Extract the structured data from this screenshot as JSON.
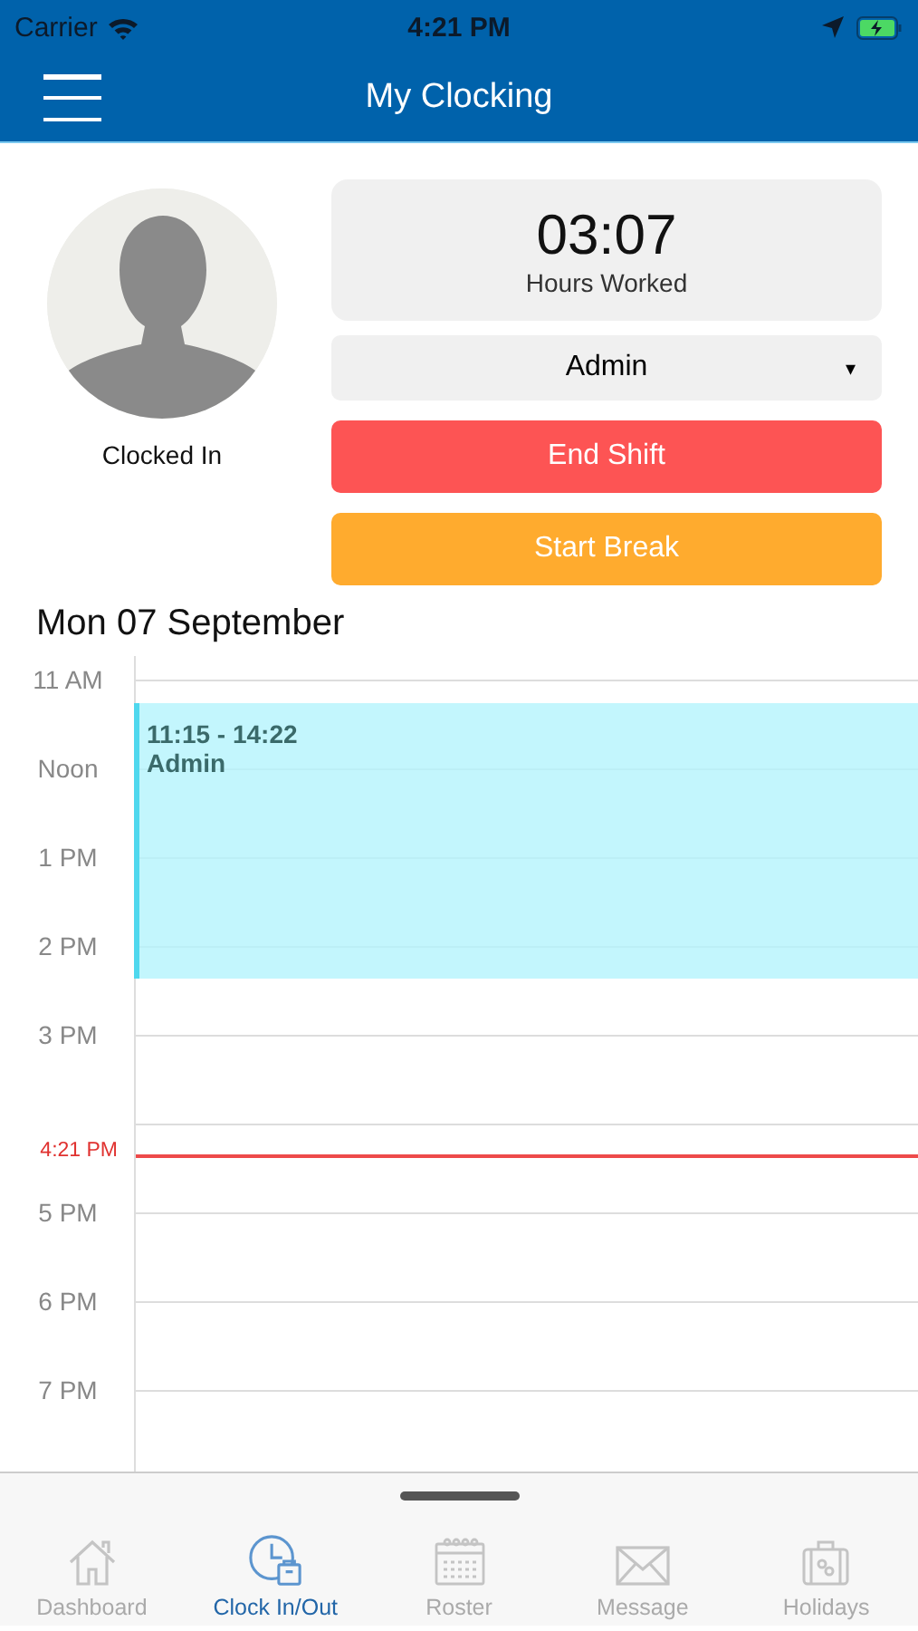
{
  "status_bar": {
    "carrier": "Carrier",
    "time": "4:21 PM"
  },
  "header": {
    "title": "My Clocking"
  },
  "profile": {
    "status": "Clocked In"
  },
  "hours_worked": {
    "value": "03:07",
    "label": "Hours Worked"
  },
  "role_select": {
    "value": "Admin",
    "arrow": "▾"
  },
  "buttons": [
    {
      "label": "End Shift",
      "kind": "danger"
    },
    {
      "label": "Start Break",
      "kind": "warning"
    }
  ],
  "date": "Mon 07 September",
  "timeline": {
    "rows": [
      {
        "kind": "hour",
        "label": "11 AM"
      },
      {
        "kind": "hour",
        "label": "Noon"
      },
      {
        "kind": "hour",
        "label": "1 PM"
      },
      {
        "kind": "hour",
        "label": "2 PM"
      },
      {
        "kind": "hour",
        "label": "3 PM"
      },
      {
        "kind": "now",
        "label": "4:21 PM"
      },
      {
        "kind": "hour",
        "label": "5 PM"
      },
      {
        "kind": "hour",
        "label": "6 PM"
      },
      {
        "kind": "hour",
        "label": "7 PM"
      }
    ],
    "event": {
      "time": "11:15 - 14:22",
      "role": "Admin"
    }
  },
  "tabs": [
    {
      "label": "Dashboard",
      "kind": "home",
      "selected": false
    },
    {
      "label": "Clock In/Out",
      "kind": "clock",
      "selected": true
    },
    {
      "label": "Roster",
      "kind": "calendar",
      "selected": false
    },
    {
      "label": "Message",
      "kind": "mail",
      "selected": false
    },
    {
      "label": "Holidays",
      "kind": "suitcase",
      "selected": false
    }
  ]
}
